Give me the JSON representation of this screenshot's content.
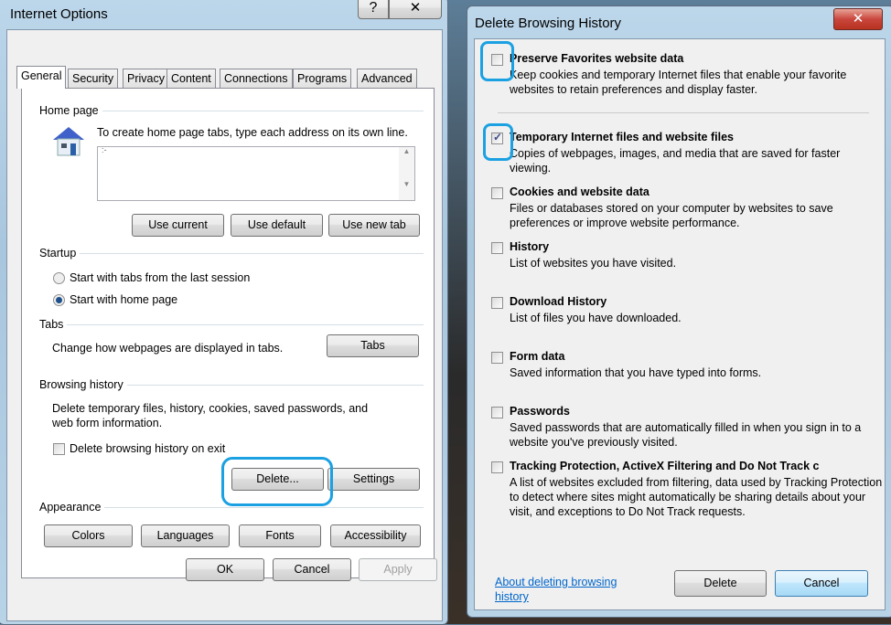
{
  "internet_options": {
    "title": "Internet Options",
    "tabs": [
      "General",
      "Security",
      "Privacy",
      "Content",
      "Connections",
      "Programs",
      "Advanced"
    ],
    "home_page": {
      "label": "Home page",
      "instruction": "To create home page tabs, type each address on its own line.",
      "value": ":-",
      "buttons": [
        "Use current",
        "Use default",
        "Use new tab"
      ]
    },
    "startup": {
      "label": "Startup",
      "options": [
        {
          "label": "Start with tabs from the last session",
          "selected": false
        },
        {
          "label": "Start with home page",
          "selected": true
        }
      ]
    },
    "tabs_group": {
      "label": "Tabs",
      "text": "Change how webpages are displayed in tabs.",
      "button": "Tabs"
    },
    "browsing_history": {
      "label": "Browsing history",
      "text": "Delete temporary files, history, cookies, saved passwords, and web form information.",
      "checkbox": "Delete browsing history on exit",
      "checked": false,
      "delete_button": "Delete...",
      "settings_button": "Settings"
    },
    "appearance": {
      "label": "Appearance",
      "buttons": [
        "Colors",
        "Languages",
        "Fonts",
        "Accessibility"
      ]
    },
    "footer": {
      "ok": "OK",
      "cancel": "Cancel",
      "apply": "Apply"
    }
  },
  "delete_history": {
    "title": "Delete Browsing History",
    "items": [
      {
        "label": "Preserve Favorites website data",
        "desc": "Keep cookies and temporary Internet files that enable your favorite websites to retain preferences and display faster.",
        "checked": false
      },
      {
        "label": "Temporary Internet files and website files",
        "desc": "Copies of webpages, images, and media that are saved for faster viewing.",
        "checked": true
      },
      {
        "label": "Cookies and website data",
        "desc": "Files or databases stored on your computer by websites to save preferences or improve website performance.",
        "checked": false
      },
      {
        "label": "History",
        "desc": "List of websites you have visited.",
        "checked": false
      },
      {
        "label": "Download History",
        "desc": "List of files you have downloaded.",
        "checked": false
      },
      {
        "label": "Form data",
        "desc": "Saved information that you have typed into forms.",
        "checked": false
      },
      {
        "label": "Passwords",
        "desc": "Saved passwords that are automatically filled in when you sign in to a website you've previously visited.",
        "checked": false
      },
      {
        "label": "Tracking Protection, ActiveX Filtering and Do Not Track c",
        "desc": "A list of websites excluded from filtering, data used by Tracking Protection to detect where sites might automatically be sharing details about your visit, and exceptions to Do Not Track requests.",
        "checked": false
      }
    ],
    "link": "About deleting browsing history",
    "delete": "Delete",
    "cancel": "Cancel"
  },
  "colors": {
    "highlight": "#1ba1e2",
    "close_button": "#c9463d"
  }
}
